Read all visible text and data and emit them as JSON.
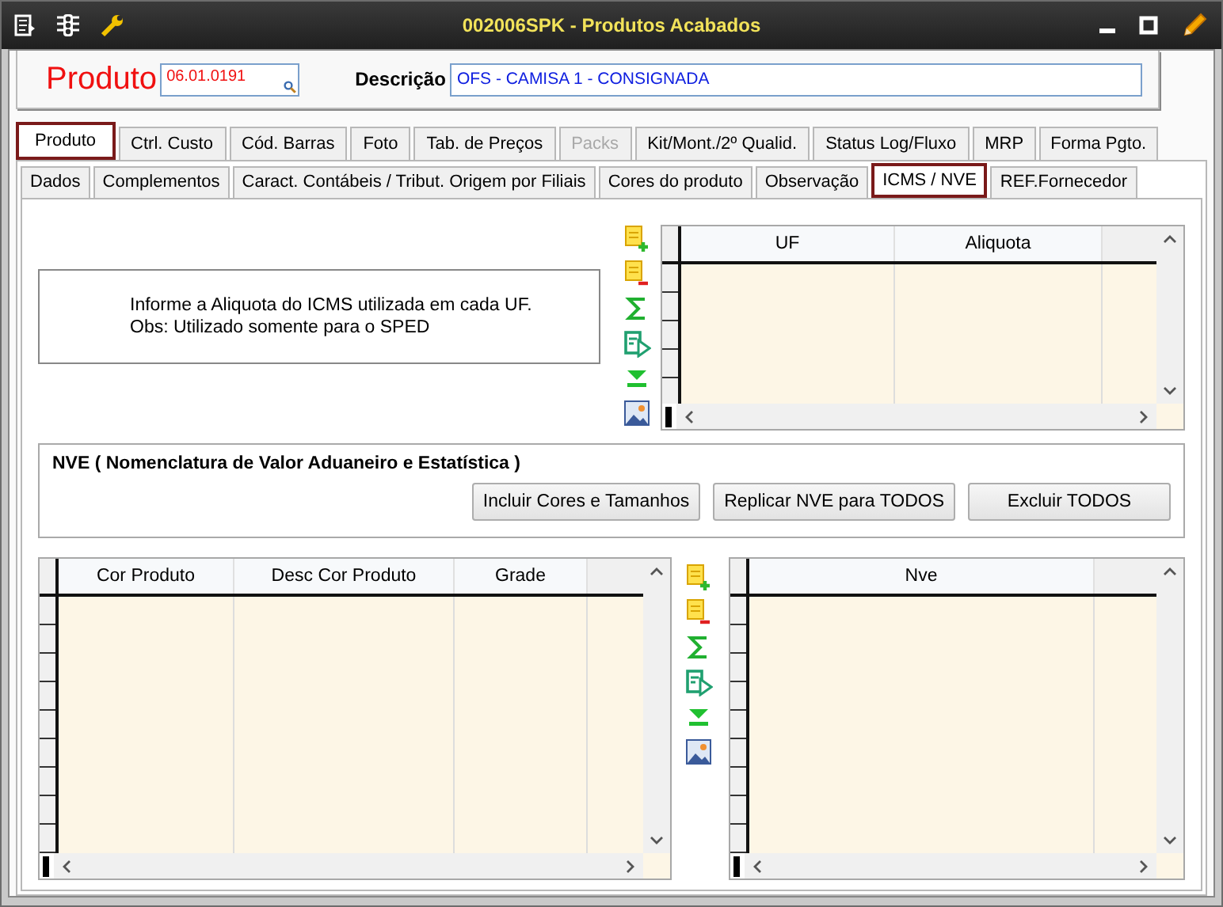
{
  "window": {
    "title": "002006SPK - Produtos Acabados"
  },
  "header": {
    "product_label": "Produto",
    "product_code": "06.01.0191",
    "description_label": "Descrição",
    "description": "OFS - CAMISA 1 - CONSIGNADA"
  },
  "tabs": [
    {
      "label": "Produto",
      "selected": true,
      "disabled": false
    },
    {
      "label": "Ctrl. Custo",
      "selected": false,
      "disabled": false
    },
    {
      "label": "Cód. Barras",
      "selected": false,
      "disabled": false
    },
    {
      "label": "Foto",
      "selected": false,
      "disabled": false
    },
    {
      "label": "Tab. de Preços",
      "selected": false,
      "disabled": false
    },
    {
      "label": "Packs",
      "selected": false,
      "disabled": true
    },
    {
      "label": "Kit/Mont./2º Qualid.",
      "selected": false,
      "disabled": false
    },
    {
      "label": "Status Log/Fluxo",
      "selected": false,
      "disabled": false
    },
    {
      "label": "MRP",
      "selected": false,
      "disabled": false
    },
    {
      "label": "Forma Pgto.",
      "selected": false,
      "disabled": false
    }
  ],
  "subtabs": [
    {
      "label": "Dados",
      "selected": false
    },
    {
      "label": "Complementos",
      "selected": false
    },
    {
      "label": "Caract. Contábeis / Tribut. Origem por Filiais",
      "selected": false
    },
    {
      "label": "Cores do produto",
      "selected": false
    },
    {
      "label": "Observação",
      "selected": false
    },
    {
      "label": "ICMS / NVE",
      "selected": true
    },
    {
      "label": "REF.Fornecedor",
      "selected": false
    }
  ],
  "info": {
    "lines": [
      "Informe a Aliquota do ICMS utilizada em cada UF.",
      "Obs: Utilizado somente para o SPED"
    ]
  },
  "uf_grid": {
    "columns": [
      "UF",
      "Aliquota"
    ]
  },
  "nve_section": {
    "title": "NVE ( Nomenclatura de Valor Aduaneiro e Estatística )",
    "buttons": [
      "Incluir Cores e Tamanhos",
      "Replicar NVE para TODOS",
      "Excluir TODOS"
    ]
  },
  "color_grid": {
    "columns": [
      "Cor Produto",
      "Desc Cor Produto",
      "Grade"
    ]
  },
  "nve_grid": {
    "columns": [
      "Nve"
    ]
  }
}
